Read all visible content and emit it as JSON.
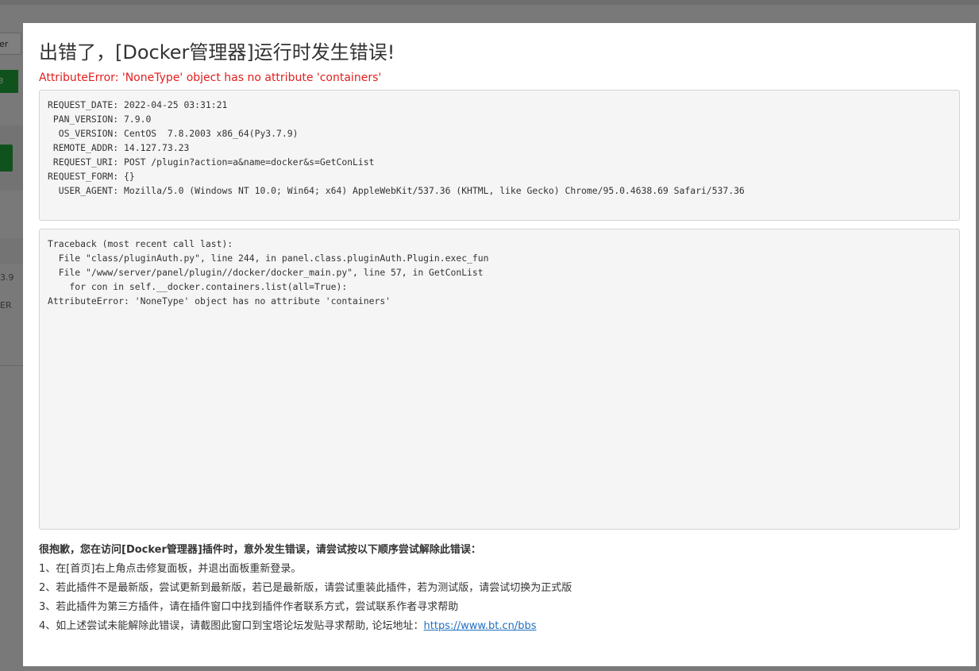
{
  "background": {
    "input_fragment": "er",
    "button_fragment": "3",
    "cell_1": "3.9",
    "cell_2": "ER"
  },
  "modal": {
    "title": "出错了，[Docker管理器]运行时发生错误!",
    "error_message": "AttributeError: 'NoneType' object has no attribute 'containers'",
    "request_info": [
      "REQUEST_DATE: 2022-04-25 03:31:21",
      " PAN_VERSION: 7.9.0",
      "  OS_VERSION: CentOS  7.8.2003 x86_64(Py3.7.9)",
      " REMOTE_ADDR: 14.127.73.23",
      " REQUEST_URI: POST /plugin?action=a&name=docker&s=GetConList",
      "REQUEST_FORM: {}",
      "  USER_AGENT: Mozilla/5.0 (Windows NT 10.0; Win64; x64) AppleWebKit/537.36 (KHTML, like Gecko) Chrome/95.0.4638.69 Safari/537.36"
    ],
    "traceback": [
      "Traceback (most recent call last):",
      "  File \"class/pluginAuth.py\", line 244, in panel.class.pluginAuth.Plugin.exec_fun",
      "  File \"/www/server/panel/plugin//docker/docker_main.py\", line 57, in GetConList",
      "    for con in self.__docker.containers.list(all=True):",
      "AttributeError: 'NoneType' object has no attribute 'containers'"
    ],
    "help_title": "很抱歉，您在访问[Docker管理器]插件时，意外发生错误，请尝试按以下顺序尝试解除此错误：",
    "help_steps": [
      "1、在[首页]右上角点击修复面板，并退出面板重新登录。",
      "2、若此插件不是最新版，尝试更新到最新版，若已是最新版，请尝试重装此插件，若为测试版，请尝试切换为正式版",
      "3、若此插件为第三方插件，请在插件窗口中找到插件作者联系方式，尝试联系作者寻求帮助",
      "4、如上述尝试未能解除此错误，请截图此窗口到宝塔论坛发贴寻求帮助, 论坛地址："
    ],
    "forum_link": "https://www.bt.cn/bbs",
    "link_color": "#1f6fbf",
    "error_color": "#e21e1e"
  }
}
